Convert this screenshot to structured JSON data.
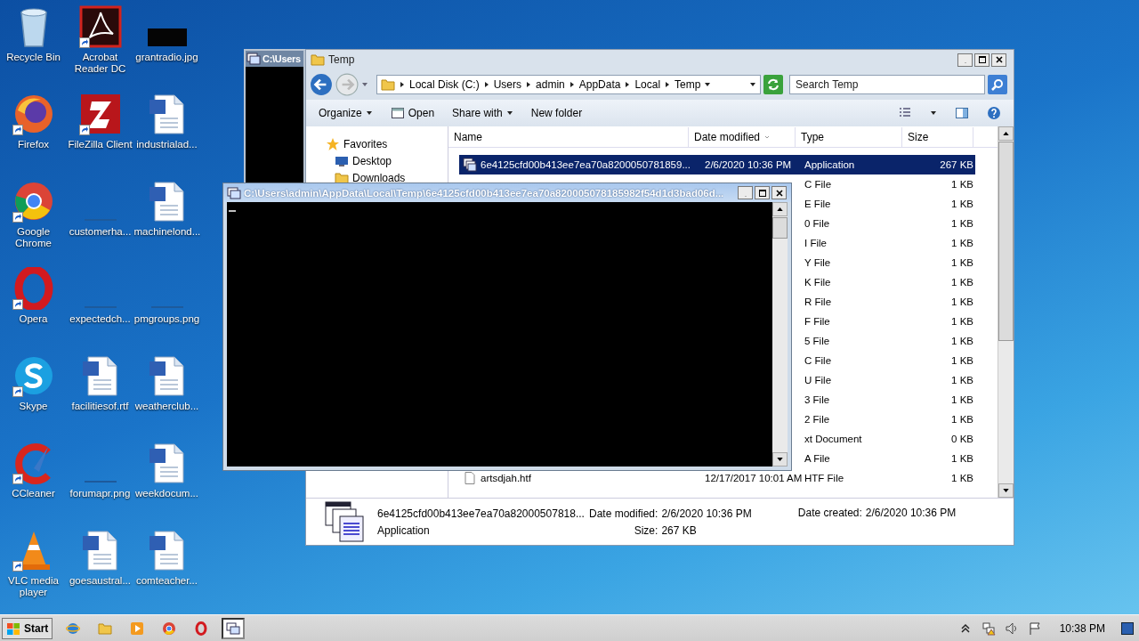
{
  "desktop_icons": [
    {
      "label": "Recycle Bin",
      "kind": "recycle",
      "shortcut": false
    },
    {
      "label": "Acrobat Reader DC",
      "kind": "acrobat",
      "shortcut": true
    },
    {
      "label": "grantradio.jpg",
      "kind": "image",
      "shortcut": false
    },
    {
      "label": "Firefox",
      "kind": "firefox",
      "shortcut": true
    },
    {
      "label": "FileZilla Client",
      "kind": "filezilla",
      "shortcut": true
    },
    {
      "label": "industrialad...",
      "kind": "word",
      "shortcut": false
    },
    {
      "label": "Google Chrome",
      "kind": "chrome",
      "shortcut": true
    },
    {
      "label": "customerha...",
      "kind": "blank",
      "shortcut": false
    },
    {
      "label": "machinelond...",
      "kind": "word",
      "shortcut": false
    },
    {
      "label": "Opera",
      "kind": "opera",
      "shortcut": true
    },
    {
      "label": "expectedch...",
      "kind": "blank",
      "shortcut": false
    },
    {
      "label": "pmgroups.png",
      "kind": "blank",
      "shortcut": false
    },
    {
      "label": "Skype",
      "kind": "skype",
      "shortcut": true
    },
    {
      "label": "facilitiesof.rtf",
      "kind": "word",
      "shortcut": false
    },
    {
      "label": "weatherclub...",
      "kind": "word",
      "shortcut": false
    },
    {
      "label": "CCleaner",
      "kind": "ccleaner",
      "shortcut": true
    },
    {
      "label": "forumapr.png",
      "kind": "blank",
      "shortcut": false
    },
    {
      "label": "weekdocum...",
      "kind": "word",
      "shortcut": false
    },
    {
      "label": "VLC media player",
      "kind": "vlc",
      "shortcut": true
    },
    {
      "label": "goesaustral...",
      "kind": "word",
      "shortcut": false
    },
    {
      "label": "comteacher...",
      "kind": "word",
      "shortcut": false
    }
  ],
  "background_window": {
    "title": "C:\\Users"
  },
  "explorer": {
    "title": "Temp",
    "breadcrumbs": [
      "Local Disk (C:)",
      "Users",
      "admin",
      "AppData",
      "Local",
      "Temp"
    ],
    "search": {
      "placeholder": "Search Temp"
    },
    "commands": [
      {
        "label": "Organize",
        "kind": "menu"
      },
      {
        "label": "Open",
        "kind": "open"
      },
      {
        "label": "Share with",
        "kind": "menu"
      },
      {
        "label": "New folder",
        "kind": "plain"
      }
    ],
    "nav": [
      {
        "label": "Favorites",
        "kind": "star"
      },
      {
        "label": "Desktop",
        "kind": "desktop"
      },
      {
        "label": "Downloads",
        "kind": "folder"
      }
    ],
    "columns": [
      {
        "label": "Name",
        "sorted": false
      },
      {
        "label": "Date modified",
        "sorted": true
      },
      {
        "label": "Type",
        "sorted": false
      },
      {
        "label": "Size",
        "sorted": false
      }
    ],
    "files": [
      {
        "name": "6e4125cfd00b413ee7ea70a8200050781859...",
        "date": "2/6/2020 10:36 PM",
        "type": "Application",
        "size": "267 KB",
        "kind": "application",
        "selected": true
      },
      {
        "type": "C File",
        "size": "1 KB",
        "selected": false
      },
      {
        "type": "E File",
        "size": "1 KB",
        "selected": false
      },
      {
        "type": "0 File",
        "size": "1 KB",
        "selected": false
      },
      {
        "type": "I File",
        "size": "1 KB",
        "selected": false
      },
      {
        "type": "Y File",
        "size": "1 KB",
        "selected": false
      },
      {
        "type": "K File",
        "size": "1 KB",
        "selected": false
      },
      {
        "type": "R File",
        "size": "1 KB",
        "selected": false
      },
      {
        "type": "F File",
        "size": "1 KB",
        "selected": false
      },
      {
        "type": "5 File",
        "size": "1 KB",
        "selected": false
      },
      {
        "type": "C File",
        "size": "1 KB",
        "selected": false
      },
      {
        "type": "U File",
        "size": "1 KB",
        "selected": false
      },
      {
        "type": "3 File",
        "size": "1 KB",
        "selected": false
      },
      {
        "type": "2 File",
        "size": "1 KB",
        "selected": false
      },
      {
        "type": "xt Document",
        "size": "0 KB",
        "selected": false
      },
      {
        "type": "A File",
        "size": "1 KB",
        "selected": false
      },
      {
        "name": "artsdjah.htf",
        "date": "12/17/2017 10:01 AM",
        "type": "HTF File",
        "size": "1 KB",
        "kind": "file",
        "selected": false
      }
    ],
    "details": {
      "name": "6e4125cfd00b413ee7ea70a82000507818...",
      "type": "Application",
      "date_modified_label": "Date modified:",
      "date_modified": "2/6/2020 10:36 PM",
      "size_label": "Size:",
      "size": "267 KB",
      "date_created_label": "Date created:",
      "date_created": "2/6/2020 10:36 PM"
    }
  },
  "console": {
    "title": "C:\\Users\\admin\\AppData\\Local\\Temp\\6e4125cfd00b413ee7ea70a820005078185982f54d1d3bad06d...",
    "cursor_visible": true
  },
  "taskbar": {
    "start": "Start",
    "buttons": [
      {
        "kind": "ie",
        "selected": false
      },
      {
        "kind": "explorer",
        "selected": false
      },
      {
        "kind": "media",
        "selected": false
      },
      {
        "kind": "chrome",
        "selected": false
      },
      {
        "kind": "opera",
        "selected": false
      },
      {
        "kind": "console",
        "selected": true
      }
    ],
    "clock": "10:38 PM"
  }
}
